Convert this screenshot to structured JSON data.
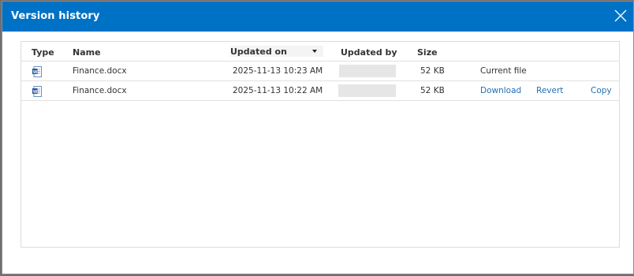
{
  "dialog": {
    "title": "Version history"
  },
  "table": {
    "headers": {
      "type": "Type",
      "name": "Name",
      "updated_on": "Updated on",
      "updated_by": "Updated by",
      "size": "Size"
    },
    "sort": {
      "column": "updated_on",
      "direction": "descending"
    },
    "rows": [
      {
        "type_icon": "word-document-icon",
        "name": "Finance.docx",
        "updated_on": "2025-11-13 10:23 AM",
        "updated_by": "",
        "size": "52 KB",
        "status": "Current file"
      },
      {
        "type_icon": "word-document-icon",
        "name": "Finance.docx",
        "updated_on": "2025-11-13 10:22 AM",
        "updated_by": "",
        "size": "52 KB",
        "actions": {
          "download": "Download",
          "revert": "Revert",
          "copy": "Copy"
        }
      }
    ]
  },
  "colors": {
    "titlebar": "#0072c6",
    "link": "#1f6fb4",
    "text": "#333333"
  }
}
